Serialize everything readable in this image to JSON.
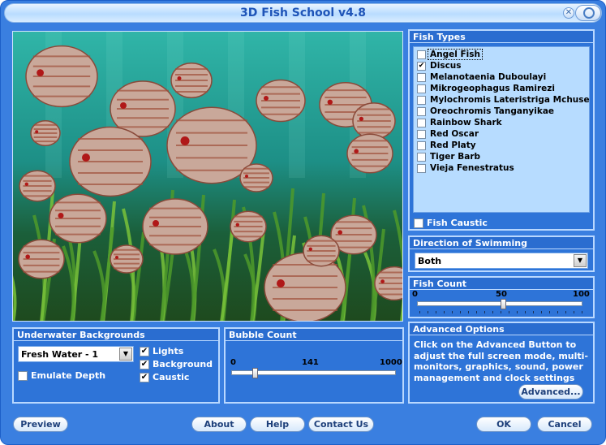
{
  "window": {
    "title": "3D Fish School v4.8"
  },
  "fish_types": {
    "title": "Fish Types",
    "items": [
      {
        "label": "Angel Fish",
        "checked": false
      },
      {
        "label": "Discus",
        "checked": true
      },
      {
        "label": "Melanotaenia Duboulayi",
        "checked": false
      },
      {
        "label": "Mikrogeophagus Ramirezi",
        "checked": false
      },
      {
        "label": "Mylochromis Lateristriga Mchuse",
        "checked": false
      },
      {
        "label": "Oreochromis Tanganyikae",
        "checked": false
      },
      {
        "label": "Rainbow Shark",
        "checked": false
      },
      {
        "label": "Red Oscar",
        "checked": false
      },
      {
        "label": "Red Platy",
        "checked": false
      },
      {
        "label": "Tiger Barb",
        "checked": false
      },
      {
        "label": "Vieja Fenestratus",
        "checked": false
      }
    ],
    "fish_caustic_label": "Fish Caustic",
    "fish_caustic_checked": false
  },
  "direction": {
    "title": "Direction of Swimming",
    "selected": "Both"
  },
  "fish_count": {
    "title": "Fish Count",
    "min": "0",
    "mid": "50",
    "max": "100",
    "value": 52
  },
  "advanced": {
    "title": "Advanced Options",
    "text": "Click on the Advanced Button to adjust the full screen mode, multi-monitors, graphics, sound, power management and clock settings",
    "button_label": "Advanced..."
  },
  "backgrounds": {
    "title": "Underwater Backgrounds",
    "selected": "Fresh Water - 1",
    "emulate_depth_label": "Emulate Depth",
    "emulate_depth_checked": false,
    "lights_label": "Lights",
    "lights_checked": true,
    "background_label": "Background",
    "background_checked": true,
    "caustic_label": "Caustic",
    "caustic_checked": true
  },
  "bubble_count": {
    "title": "Bubble Count",
    "min": "0",
    "mid": "141",
    "max": "1000",
    "value": 141
  },
  "buttons": {
    "preview": "Preview",
    "about": "About",
    "help": "Help",
    "contact": "Contact Us",
    "ok": "OK",
    "cancel": "Cancel"
  },
  "colors": {
    "window_bg": "#3a7fe0",
    "panel_bg": "#2e74d8",
    "list_bg": "#b7dcff",
    "title_text": "#1e54b8"
  }
}
